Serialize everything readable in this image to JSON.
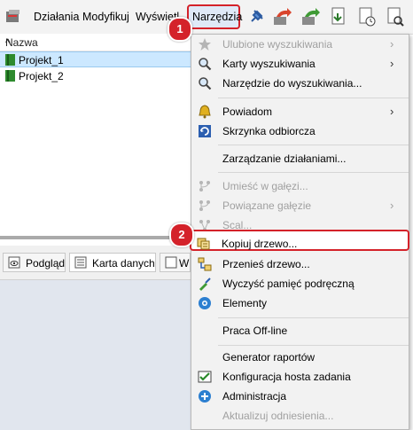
{
  "menubar": {
    "items": [
      "Działania",
      "Modyfikuj",
      "Wyświetl",
      "Narzędzia"
    ]
  },
  "tree": {
    "column_header": "Nazwa",
    "rows": [
      "Projekt_1",
      "Projekt_2"
    ]
  },
  "tabs": [
    "Podgląd",
    "Karta danych",
    "W"
  ],
  "dropdown": {
    "items": [
      {
        "label": "Ulubione wyszukiwania",
        "disabled": true,
        "submenu": true,
        "icon": "star-icon"
      },
      {
        "label": "Karty wyszukiwania",
        "disabled": false,
        "submenu": true,
        "icon": "magnifier-icon"
      },
      {
        "label": "Narzędzie do wyszukiwania...",
        "disabled": false,
        "submenu": false,
        "icon": "magnifier-icon"
      },
      {
        "label": "Powiadom",
        "disabled": false,
        "submenu": true,
        "icon": "bell-icon"
      },
      {
        "label": "Skrzynka odbiorcza",
        "disabled": false,
        "submenu": false,
        "icon": "inbox-refresh-icon"
      },
      {
        "label": "Zarządzanie działaniami...",
        "disabled": false,
        "submenu": false,
        "icon": ""
      },
      {
        "label": "Umieść w gałęzi...",
        "disabled": true,
        "submenu": false,
        "icon": "branch-icon"
      },
      {
        "label": "Powiązane gałęzie",
        "disabled": true,
        "submenu": true,
        "icon": "branch-icon"
      },
      {
        "label": "Scal...",
        "disabled": true,
        "submenu": false,
        "icon": "merge-icon"
      },
      {
        "label": "Kopiuj drzewo...",
        "disabled": false,
        "submenu": false,
        "icon": "copy-tree-icon"
      },
      {
        "label": "Przenieś drzewo...",
        "disabled": false,
        "submenu": false,
        "icon": "move-tree-icon"
      },
      {
        "label": "Wyczyść pamięć podręczną",
        "disabled": false,
        "submenu": false,
        "icon": "clear-cache-icon"
      },
      {
        "label": "Elementy",
        "disabled": false,
        "submenu": false,
        "icon": "elements-icon"
      },
      {
        "label": "Praca Off-line",
        "disabled": false,
        "submenu": false,
        "icon": ""
      },
      {
        "label": "Generator raportów",
        "disabled": false,
        "submenu": false,
        "icon": ""
      },
      {
        "label": "Konfiguracja hosta zadania",
        "disabled": false,
        "submenu": false,
        "icon": "check-icon"
      },
      {
        "label": "Administracja",
        "disabled": false,
        "submenu": false,
        "icon": "admin-icon"
      },
      {
        "label": "Aktualizuj odniesienia...",
        "disabled": true,
        "submenu": false,
        "icon": ""
      }
    ]
  },
  "badges": [
    "1",
    "2"
  ],
  "colors": {
    "highlight_red": "#d4222a",
    "selection_blue": "#cce8ff"
  }
}
